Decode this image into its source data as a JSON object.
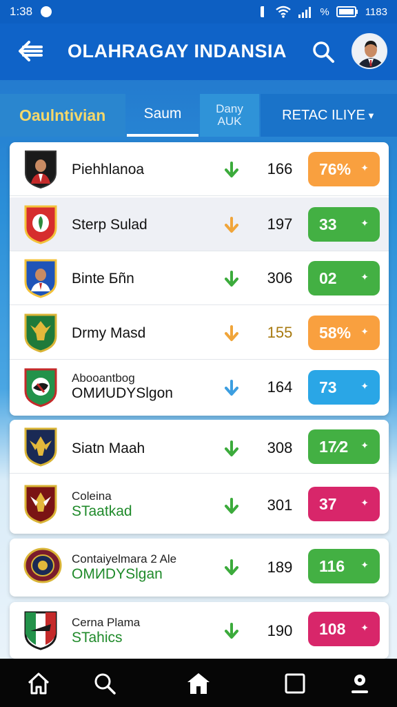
{
  "status_bar": {
    "time": "1:38",
    "battery_text": "%",
    "battery_level": "1183"
  },
  "app_bar": {
    "title": "OLAHRAGAY INDANSIA"
  },
  "tabs": [
    {
      "label": "Oaulntivian"
    },
    {
      "label": "Saum"
    },
    {
      "label_line1": "Dany",
      "label_line2": "AUK"
    },
    {
      "label": "RETAC ILIYE"
    }
  ],
  "colors": {
    "orange": "#f9a03f",
    "green": "#43b043",
    "blue": "#2aa6e6",
    "pink": "#d8266a",
    "arrow_green": "#3cab3c",
    "arrow_orange": "#f0a53a",
    "arrow_blue": "#3c9ee0"
  },
  "rows": [
    {
      "name_line1": "",
      "name_line2": "Piehhlanoa",
      "trend": "down",
      "trend_color": "green",
      "score": "166",
      "badge": "76%",
      "badge_color": "orange"
    },
    {
      "name_line1": "",
      "name_line2": "Sterp Sulad",
      "trend": "down",
      "trend_color": "orange",
      "score": "197",
      "badge": "33",
      "badge_color": "green"
    },
    {
      "name_line1": "",
      "name_line2": "Binte Бñn",
      "trend": "down",
      "trend_color": "green",
      "score": "306",
      "badge": "02",
      "badge_color": "green"
    },
    {
      "name_line1": "",
      "name_line2": "Drmy Masd",
      "trend": "down",
      "trend_color": "orange",
      "score": "155",
      "badge": "58%",
      "badge_color": "orange"
    },
    {
      "name_line1": "Abooantbog",
      "name_line2": "ОМИUDYSlgon",
      "trend": "down",
      "trend_color": "blue",
      "score": "164",
      "badge": "73",
      "badge_color": "blue"
    },
    {
      "name_line1": "",
      "name_line2": "Siatn Maah",
      "trend": "down",
      "trend_color": "green",
      "score": "308",
      "badge": "17⁄2",
      "badge_color": "green"
    },
    {
      "name_line1": "Coleina",
      "name_line2": "STaatkad",
      "trend": "down",
      "trend_color": "green",
      "score": "301",
      "badge": "37",
      "badge_color": "pink"
    },
    {
      "name_line1": "Contaiyelmara 2 Ale",
      "name_line2": "ОМИDYSlgan",
      "trend": "down",
      "trend_color": "green",
      "score": "189",
      "badge": "116",
      "badge_color": "green"
    },
    {
      "name_line1": "Cerna Plama",
      "name_line2": "STahics",
      "trend": "down",
      "trend_color": "green",
      "score": "190",
      "badge": "108",
      "badge_color": "pink"
    }
  ],
  "bottom_nav": [
    {
      "icon": "home-icon"
    },
    {
      "icon": "search-icon"
    },
    {
      "icon": "store-icon"
    },
    {
      "icon": "square-icon"
    },
    {
      "icon": "profile-icon"
    }
  ]
}
